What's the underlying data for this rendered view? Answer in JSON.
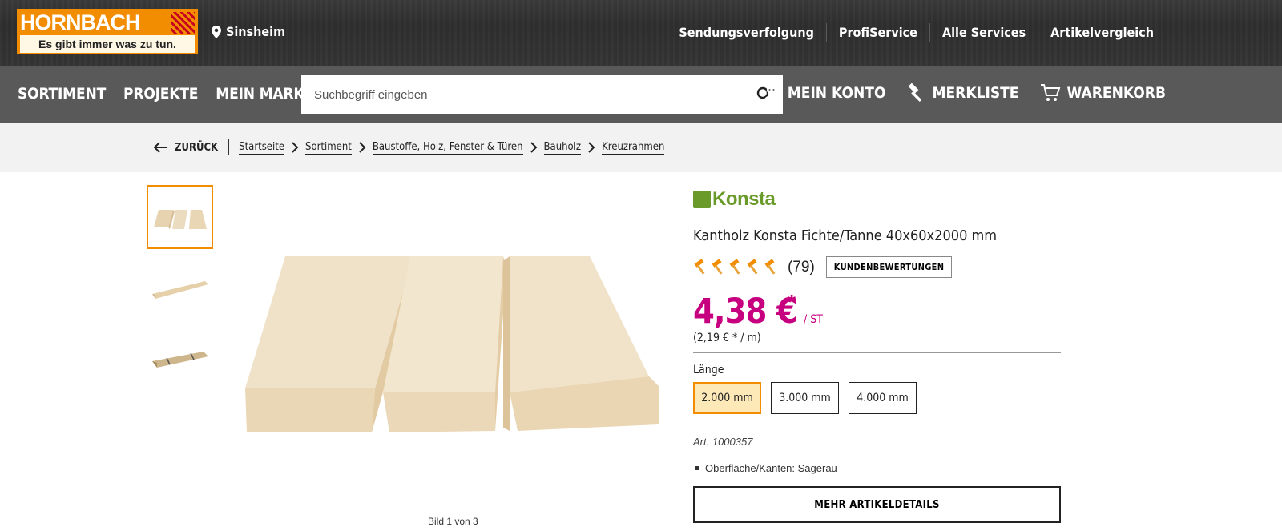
{
  "header": {
    "logo": {
      "name": "HORNBACH",
      "slogan": "Es gibt immer was zu tun."
    },
    "location": "Sinsheim",
    "links": [
      "Sendungsverfolgung",
      "ProfiService",
      "Alle Services",
      "Artikelvergleich"
    ]
  },
  "nav": {
    "menu": [
      "SORTIMENT",
      "PROJEKTE",
      "MEIN MARKT"
    ],
    "search_placeholder": "Suchbegriff eingeben",
    "account": "MEIN KONTO",
    "wishlist": "MERKLISTE",
    "cart": "WARENKORB"
  },
  "breadcrumb": {
    "back": "ZURÜCK",
    "items": [
      "Startseite",
      "Sortiment",
      "Baustoffe, Holz, Fenster & Türen",
      "Bauholz",
      "Kreuzrahmen"
    ]
  },
  "gallery": {
    "caption": "Bild 1 von 3"
  },
  "product": {
    "brand": "Konsta",
    "title": "Kantholz Konsta Fichte/Tanne 40x60x2000 mm",
    "rating_count": "(79)",
    "rating_stars": 5,
    "reviews_button": "KUNDENBEWERTUNGEN",
    "price": "4,38 €",
    "price_star": "*",
    "unit": "/ ST",
    "unit_price": "(2,19 € * / m)",
    "length_label": "Länge",
    "lengths": [
      "2.000 mm",
      "3.000 mm",
      "4.000 mm"
    ],
    "selected_length": "2.000 mm",
    "article_nr": "Art. 1000357",
    "features": [
      "Oberfläche/Kanten: Sägerau"
    ],
    "more_details": "MEHR ARTIKELDETAILS"
  },
  "colors": {
    "brand_orange": "#f28c00",
    "price_magenta": "#c6007e",
    "nav_gray": "#595959"
  }
}
